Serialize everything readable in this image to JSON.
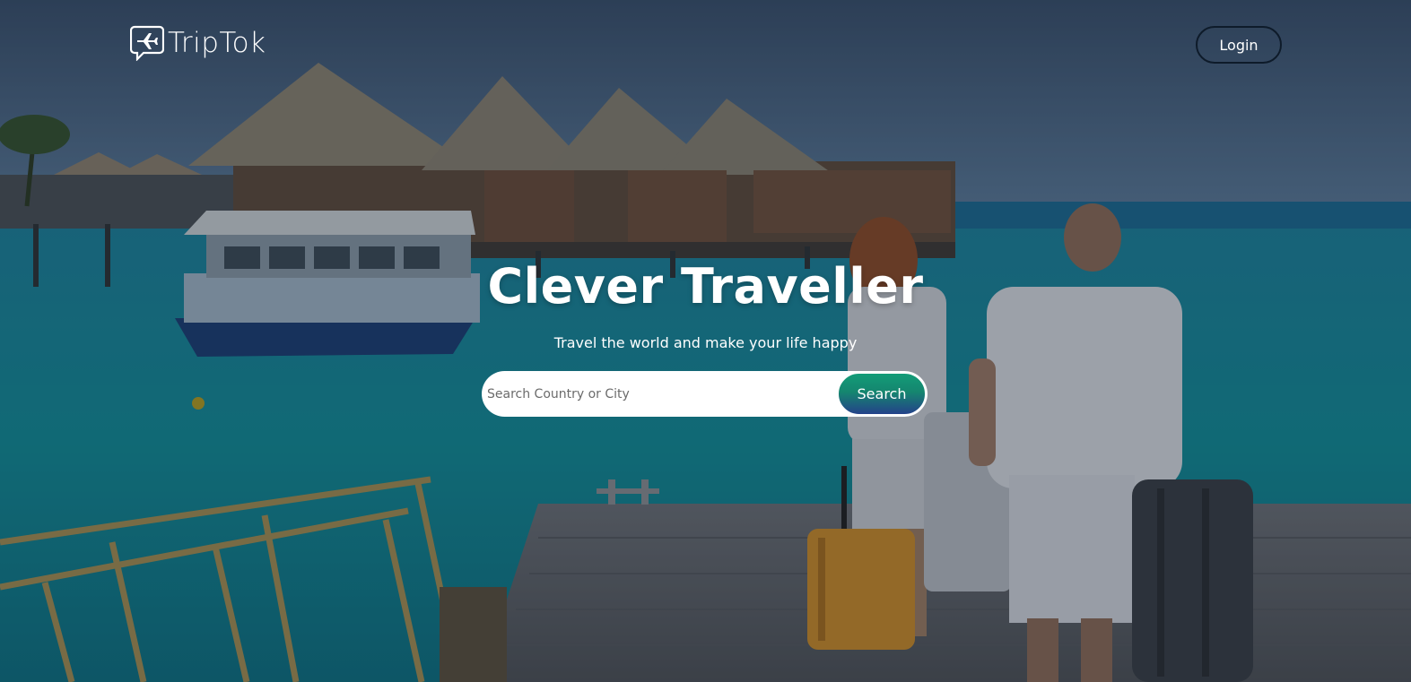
{
  "brand": {
    "name": "TripTok",
    "logo_icon": "plane-chat-bubble-icon"
  },
  "nav": {
    "login_label": "Login"
  },
  "hero": {
    "title": "Clever Traveller",
    "subtitle": "Travel the world and make your life happy"
  },
  "search": {
    "placeholder": "Search Country or City",
    "value": "",
    "button_label": "Search"
  },
  "colors": {
    "search_gradient_top": "#139c78",
    "search_gradient_bottom": "#24428a",
    "login_border": "#0e1b2a",
    "text": "#ffffff"
  }
}
